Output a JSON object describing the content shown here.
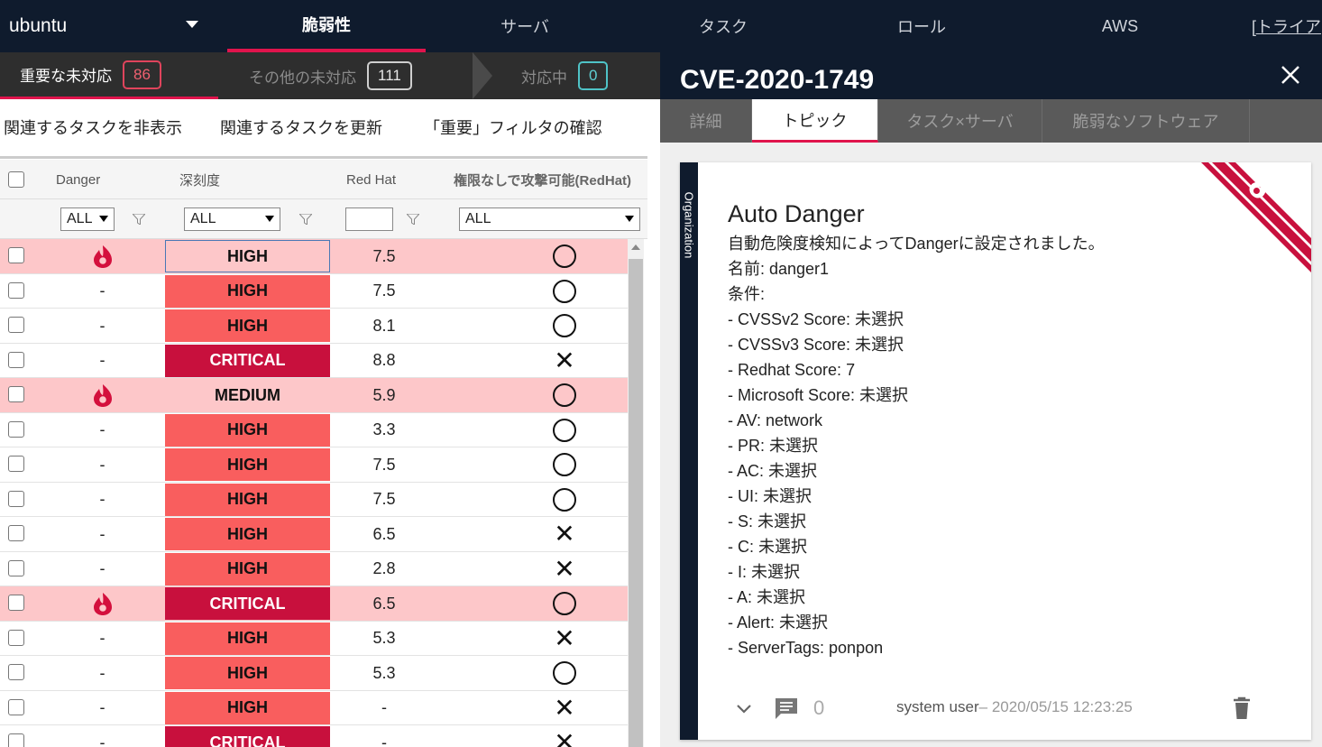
{
  "nav": {
    "host": "ubuntu",
    "tabs": [
      "脆弱性",
      "サーバ",
      "タスク",
      "ロール",
      "AWS"
    ],
    "trial": "[トライア"
  },
  "status_tabs": {
    "important": {
      "label": "重要な未対応",
      "count": "86"
    },
    "other": {
      "label": "その他の未対応",
      "count": "111"
    },
    "in_progress": {
      "label": "対応中",
      "count": "0"
    }
  },
  "actions": {
    "hide_related": "関連するタスクを非表示",
    "update_related": "関連するタスクを更新",
    "check_filter": "「重要」フィルタの確認"
  },
  "table": {
    "headers": {
      "danger": "Danger",
      "severity": "深刻度",
      "redhat": "Red Hat",
      "noauth": "権限なしで攻撃可能(RedHat)"
    },
    "filters": {
      "danger": "ALL",
      "severity": "ALL",
      "redhat": "",
      "noauth": "ALL"
    },
    "rows": [
      {
        "danger": true,
        "dash": "-",
        "severity": "HIGH",
        "score": "7.5",
        "noauth": "○",
        "pink": true,
        "selected": true
      },
      {
        "danger": false,
        "dash": "-",
        "severity": "HIGH",
        "score": "7.5",
        "noauth": "○"
      },
      {
        "danger": false,
        "dash": "-",
        "severity": "HIGH",
        "score": "8.1",
        "noauth": "○"
      },
      {
        "danger": false,
        "dash": "-",
        "severity": "CRITICAL",
        "score": "8.8",
        "noauth": "×"
      },
      {
        "danger": true,
        "dash": "-",
        "severity": "MEDIUM",
        "score": "5.9",
        "noauth": "○",
        "pink": true
      },
      {
        "danger": false,
        "dash": "-",
        "severity": "HIGH",
        "score": "3.3",
        "noauth": "○"
      },
      {
        "danger": false,
        "dash": "-",
        "severity": "HIGH",
        "score": "7.5",
        "noauth": "○"
      },
      {
        "danger": false,
        "dash": "-",
        "severity": "HIGH",
        "score": "7.5",
        "noauth": "○"
      },
      {
        "danger": false,
        "dash": "-",
        "severity": "HIGH",
        "score": "6.5",
        "noauth": "×"
      },
      {
        "danger": false,
        "dash": "-",
        "severity": "HIGH",
        "score": "2.8",
        "noauth": "×"
      },
      {
        "danger": true,
        "dash": "-",
        "severity": "CRITICAL",
        "score": "6.5",
        "noauth": "○",
        "pink": true
      },
      {
        "danger": false,
        "dash": "-",
        "severity": "HIGH",
        "score": "5.3",
        "noauth": "×"
      },
      {
        "danger": false,
        "dash": "-",
        "severity": "HIGH",
        "score": "5.3",
        "noauth": "○"
      },
      {
        "danger": false,
        "dash": "-",
        "severity": "HIGH",
        "score": "-",
        "noauth": "×"
      },
      {
        "danger": false,
        "dash": "-",
        "severity": "CRITICAL",
        "score": "-",
        "noauth": "×"
      }
    ]
  },
  "detail": {
    "cve": "CVE-2020-1749",
    "tabs": [
      "詳細",
      "トピック",
      "タスク×サーバ",
      "脆弱なソフトウェア"
    ],
    "active_tab": "トピック",
    "card": {
      "org_label": "Organization",
      "title": "Auto Danger",
      "lines": [
        "自動危険度検知によってDangerに設定されました。",
        "名前: danger1",
        "条件:",
        "- CVSSv2 Score: 未選択",
        "- CVSSv3 Score: 未選択",
        "- Redhat Score: 7",
        "- Microsoft Score: 未選択",
        "- AV: network",
        "- PR: 未選択",
        "- AC: 未選択",
        "- UI: 未選択",
        "- S: 未選択",
        "- C: 未選択",
        "- I: 未選択",
        "- A: 未選択",
        "- Alert: 未選択",
        "- ServerTags: ponpon"
      ],
      "comment_count": "0",
      "author": "system user",
      "timestamp": "– 2020/05/15 12:23:25"
    }
  },
  "colors": {
    "accent": "#e0144c",
    "navy": "#0f1b2d",
    "high": "#f95e5e",
    "critical": "#c8103d",
    "pink_row": "#fdc7c9"
  },
  "icons": [
    "caret-down-icon",
    "flame-icon",
    "filter-icon",
    "close-icon",
    "chevron-down-icon",
    "comment-icon",
    "trash-icon"
  ]
}
